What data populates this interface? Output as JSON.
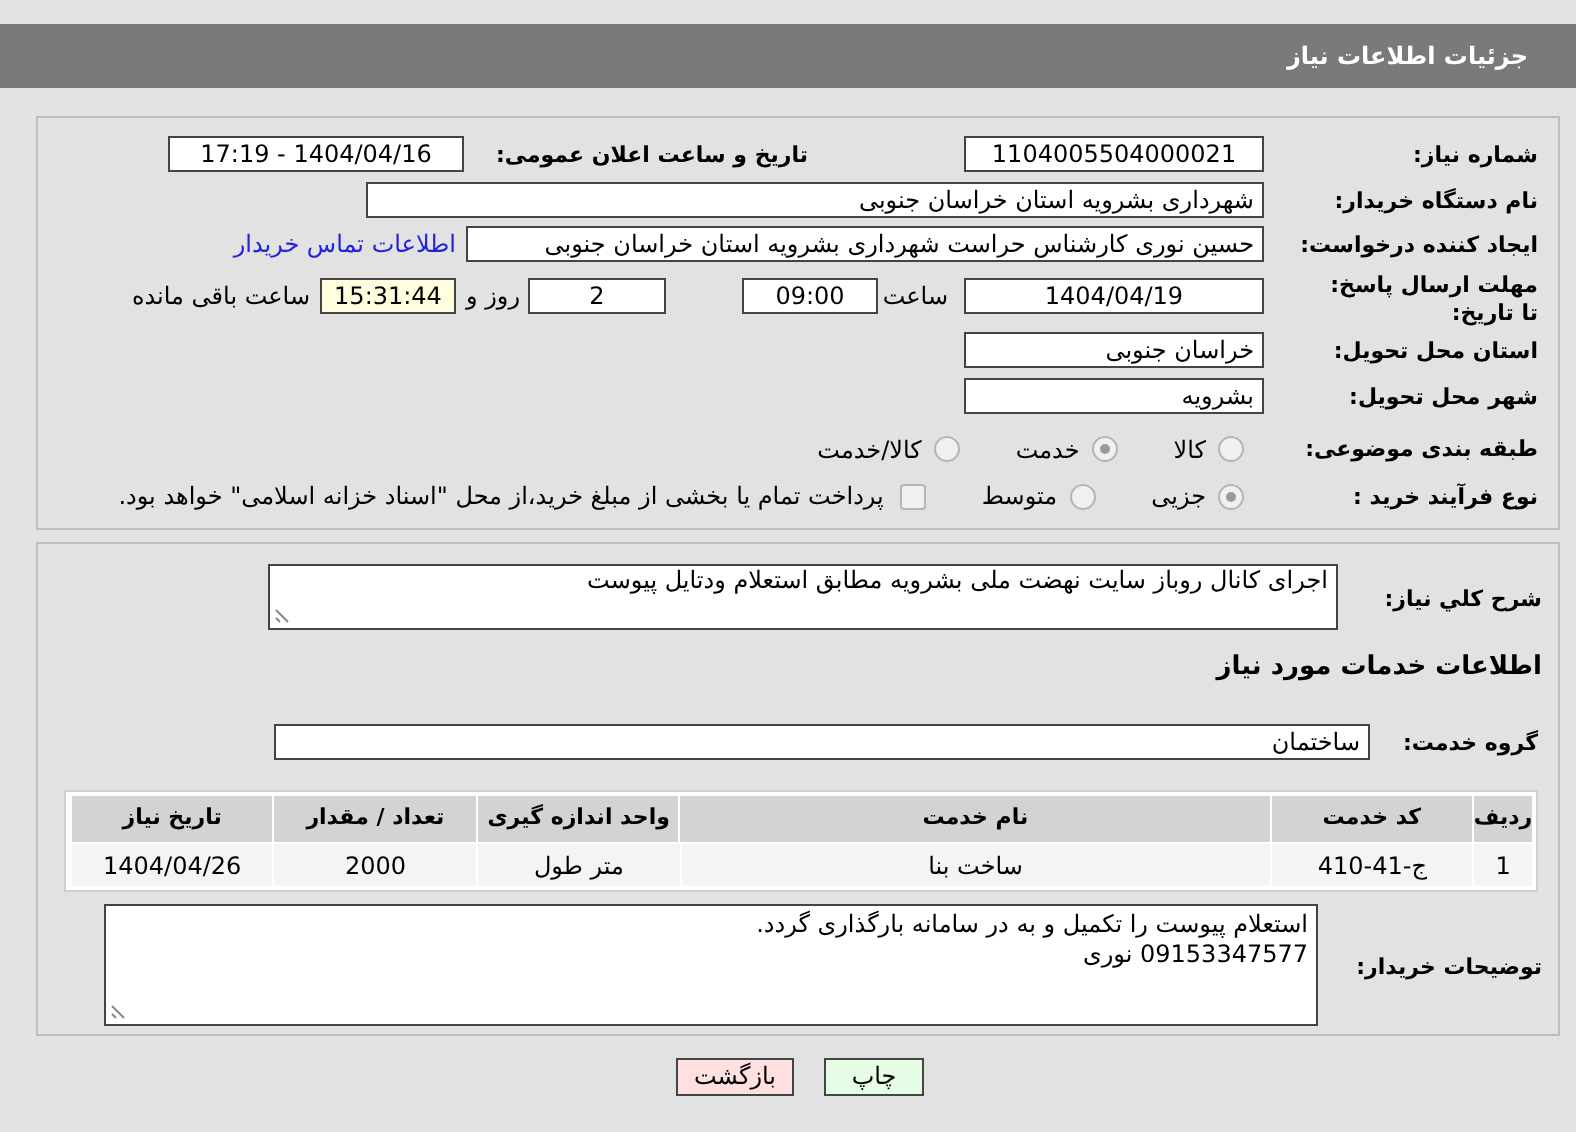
{
  "header": {
    "title": "جزئیات اطلاعات نیاز"
  },
  "need_number": {
    "label": "شماره نیاز:",
    "value": "1104005504000021"
  },
  "announce_datetime": {
    "label": "تاریخ و ساعت اعلان عمومی:",
    "value": "1404/04/16 - 17:19"
  },
  "buyer_org": {
    "label": "نام دستگاه خریدار:",
    "value": "شهرداری بشرویه استان خراسان جنوبی"
  },
  "requester": {
    "label": "ایجاد کننده درخواست:",
    "value": "حسین نوری کارشناس حراست شهرداری بشرویه استان خراسان جنوبی",
    "link": "اطلاعات تماس خریدار"
  },
  "deadline": {
    "label": "مهلت ارسال پاسخ: تا تاریخ:",
    "date": "1404/04/19",
    "time_label": "ساعت",
    "time": "09:00",
    "days": "2",
    "days_label": "روز و",
    "remaining": "15:31:44",
    "remaining_label": "ساعت باقی مانده"
  },
  "delivery_province": {
    "label": "استان محل تحویل:",
    "value": "خراسان جنوبی"
  },
  "delivery_city": {
    "label": "شهر محل تحویل:",
    "value": "بشرویه"
  },
  "category": {
    "label": "طبقه بندی موضوعی:",
    "options": [
      {
        "label": "کالا",
        "selected": false
      },
      {
        "label": "خدمت",
        "selected": true
      },
      {
        "label": "کالا/خدمت",
        "selected": false
      }
    ]
  },
  "purchase_type": {
    "label": "نوع فرآیند خرید :",
    "options": [
      {
        "label": "جزیی",
        "selected": true
      },
      {
        "label": "متوسط",
        "selected": false
      }
    ],
    "payment_note": {
      "checked": false,
      "label": "پرداخت تمام یا بخشی از مبلغ خرید،از محل \"اسناد خزانه اسلامی\" خواهد بود."
    }
  },
  "description": {
    "label": "شرح کلي نیاز:",
    "value": "اجرای کانال روباز  سایت نهضت ملی بشرویه  مطابق استعلام ودتایل پیوست"
  },
  "services_heading": "اطلاعات خدمات مورد نیاز",
  "service_group": {
    "label": "گروه خدمت:",
    "value": "ساختمان"
  },
  "table": {
    "columns": [
      "ردیف",
      "کد خدمت",
      "نام خدمت",
      "واحد اندازه گیری",
      "تعداد / مقدار",
      "تاریخ نیاز"
    ],
    "rows": [
      [
        "1",
        "ج-41-410",
        "ساخت بنا",
        "متر طول",
        "2000",
        "1404/04/26"
      ]
    ]
  },
  "buyer_notes": {
    "label": "توضیحات خریدار:",
    "lines": [
      "استعلام پیوست را تکمیل و به در سامانه بارگذاری گردد.",
      "09153347577 نوری"
    ]
  },
  "buttons": [
    {
      "kind": "print",
      "label": "چاپ"
    },
    {
      "kind": "back",
      "label": "بازگشت"
    }
  ]
}
